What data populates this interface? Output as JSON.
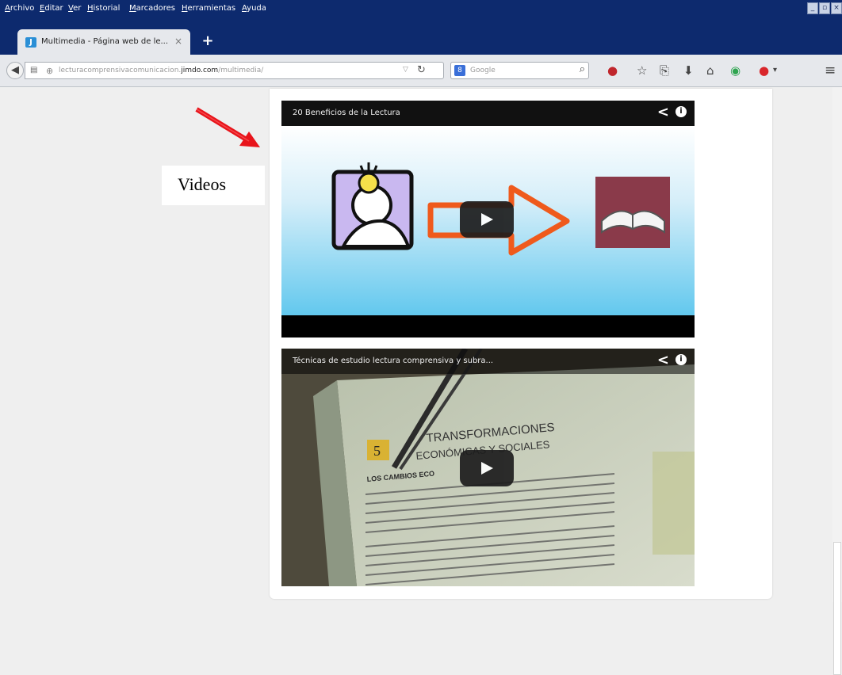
{
  "menubar": {
    "items": [
      "Archivo",
      "Editar",
      "Ver",
      "Historial",
      "Marcadores",
      "Herramientas",
      "Ayuda"
    ]
  },
  "tab": {
    "title": "Multimedia - Página web de le...",
    "close": "×",
    "new_tab": "+"
  },
  "nav": {
    "url_prefix": "lecturacomprensivacomunicacion.",
    "url_domain": "jimdo.com",
    "url_path": "/multimedia/",
    "search_placeholder": "Google",
    "search_engine_letter": "8"
  },
  "videos": [
    {
      "title": "20 Beneficios de la Lectura",
      "info": "i"
    },
    {
      "title": "Técnicas de estudio lectura comprensiva y subra...",
      "info": "i",
      "book_number": "5",
      "book_heading_1": "TRANSFORMACIONES",
      "book_heading_2": "ECONÓMICAS Y SOCIALES",
      "book_subheading": "LOS CAMBIOS ECO"
    }
  ],
  "annotation": {
    "label": "Videos",
    "arrow_color": "#e8141b"
  },
  "colors": {
    "titlebar": "#0d2a6e",
    "accent_red": "#e8141b"
  }
}
